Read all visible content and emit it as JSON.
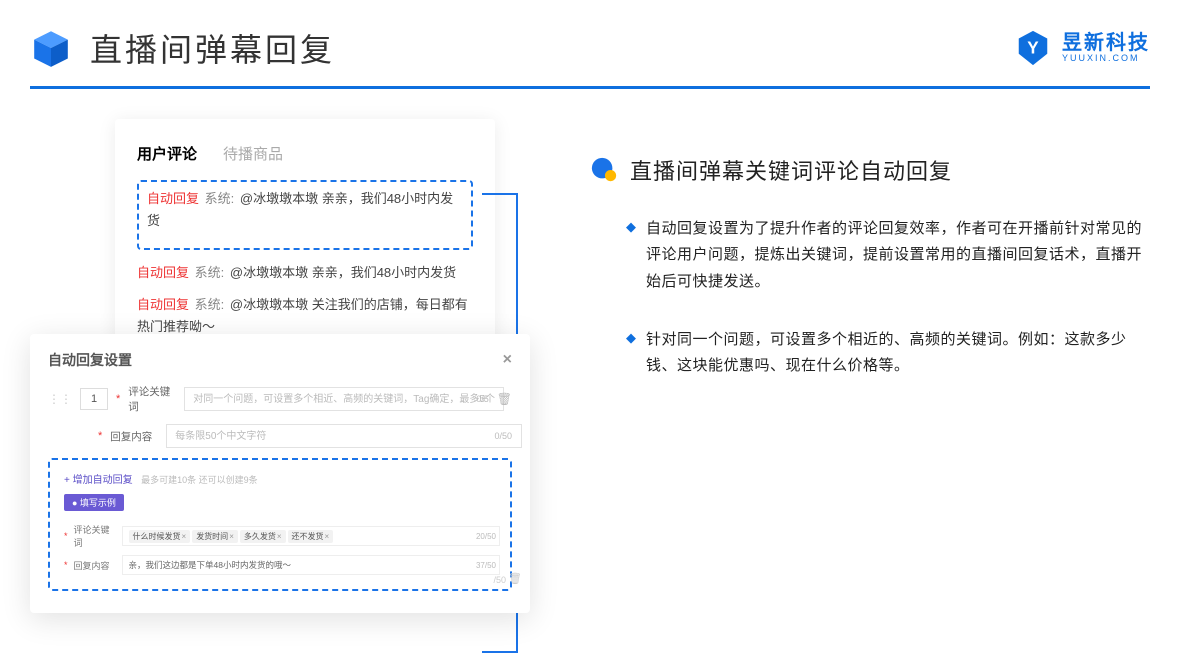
{
  "header": {
    "title": "直播间弹幕回复",
    "brand_name": "昱新科技",
    "brand_sub": "YUUXIN.COM"
  },
  "comments_card": {
    "tab_active": "用户评论",
    "tab_inactive": "待播商品",
    "auto_tag": "自动回复",
    "sys_tag": "系统:",
    "row1": "@冰墩墩本墩 亲亲，我们48小时内发货",
    "row2": "@冰墩墩本墩 亲亲，我们48小时内发货",
    "row3": "@冰墩墩本墩 关注我们的店铺，每日都有热门推荐呦～"
  },
  "settings_card": {
    "title": "自动回复设置",
    "index_value": "1",
    "keyword_label": "评论关键词",
    "keyword_placeholder": "对同一个问题，可设置多个相近、高频的关键词，Tag确定，最多5个",
    "keyword_counter": "0/5",
    "reply_label": "回复内容",
    "reply_placeholder": "每条限50个中文字符",
    "reply_counter": "0/50",
    "add_text": "+ 增加自动回复",
    "add_hint": "最多可建10条 还可以创建9条",
    "example_badge": "● 填写示例",
    "ex_keyword_label": "评论关键词",
    "ex_chips": [
      "什么时候发货",
      "发货时间",
      "多久发货",
      "还不发货"
    ],
    "ex_kw_counter": "20/50",
    "ex_reply_label": "回复内容",
    "ex_reply_value": "亲，我们这边都是下单48小时内发货的哦～",
    "ex_reply_counter": "37/50",
    "outer_counter": "/50"
  },
  "right": {
    "section_title": "直播间弹幕关键词评论自动回复",
    "bullet1": "自动回复设置为了提升作者的评论回复效率，作者可在开播前针对常见的评论用户问题，提炼出关键词，提前设置常用的直播间回复话术，直播开始后可快捷发送。",
    "bullet2": "针对同一个问题，可设置多个相近的、高频的关键词。例如：这款多少钱、这块能优惠吗、现在什么价格等。"
  }
}
